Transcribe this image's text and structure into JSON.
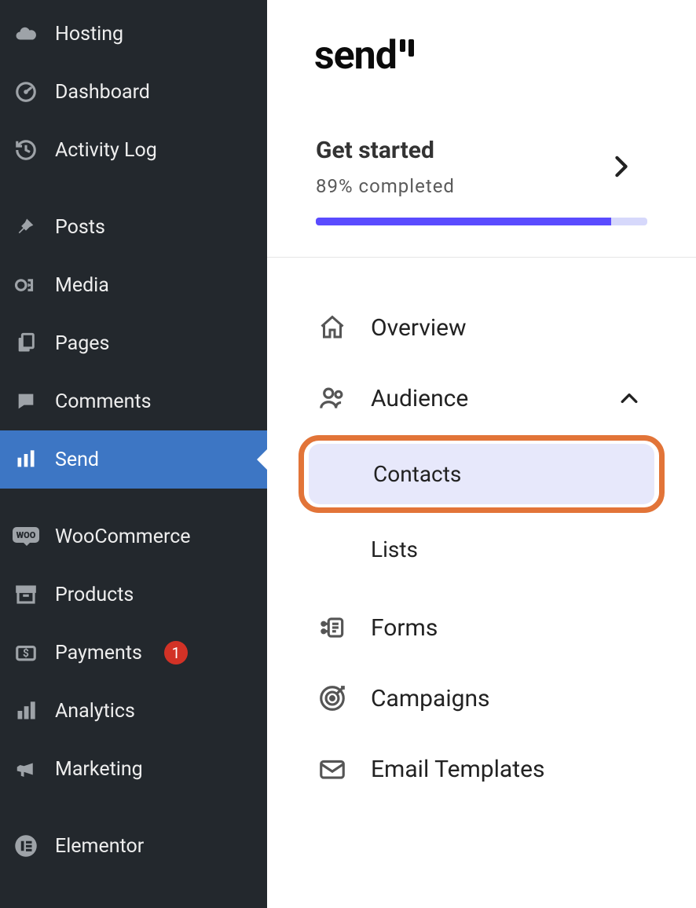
{
  "wp_sidebar": {
    "items": [
      {
        "id": "hosting",
        "label": "Hosting",
        "icon": "cloud"
      },
      {
        "id": "dashboard",
        "label": "Dashboard",
        "icon": "gauge"
      },
      {
        "id": "activity-log",
        "label": "Activity Log",
        "icon": "history"
      },
      {
        "id": "posts",
        "label": "Posts",
        "icon": "pin"
      },
      {
        "id": "media",
        "label": "Media",
        "icon": "media"
      },
      {
        "id": "pages",
        "label": "Pages",
        "icon": "pages"
      },
      {
        "id": "comments",
        "label": "Comments",
        "icon": "comment"
      },
      {
        "id": "send",
        "label": "Send",
        "icon": "bars"
      },
      {
        "id": "woocommerce",
        "label": "WooCommerce",
        "icon": "woo"
      },
      {
        "id": "products",
        "label": "Products",
        "icon": "archive"
      },
      {
        "id": "payments",
        "label": "Payments",
        "icon": "payments",
        "badge": "1"
      },
      {
        "id": "analytics",
        "label": "Analytics",
        "icon": "analytics"
      },
      {
        "id": "marketing",
        "label": "Marketing",
        "icon": "megaphone"
      },
      {
        "id": "elementor",
        "label": "Elementor",
        "icon": "elementor"
      }
    ],
    "active_id": "send",
    "separators_before": [
      "posts",
      "woocommerce",
      "elementor"
    ]
  },
  "send_panel": {
    "logo_text": "send",
    "get_started": {
      "title": "Get started",
      "completed_text": "89% completed",
      "progress_percent": 89
    },
    "nav": [
      {
        "id": "overview",
        "label": "Overview",
        "icon": "home"
      },
      {
        "id": "audience",
        "label": "Audience",
        "icon": "audience",
        "expanded": true,
        "children": [
          {
            "id": "contacts",
            "label": "Contacts",
            "selected": true,
            "highlighted": true
          },
          {
            "id": "lists",
            "label": "Lists"
          }
        ]
      },
      {
        "id": "forms",
        "label": "Forms",
        "icon": "forms"
      },
      {
        "id": "campaigns",
        "label": "Campaigns",
        "icon": "target"
      },
      {
        "id": "email-templates",
        "label": "Email Templates",
        "icon": "mail"
      }
    ]
  }
}
